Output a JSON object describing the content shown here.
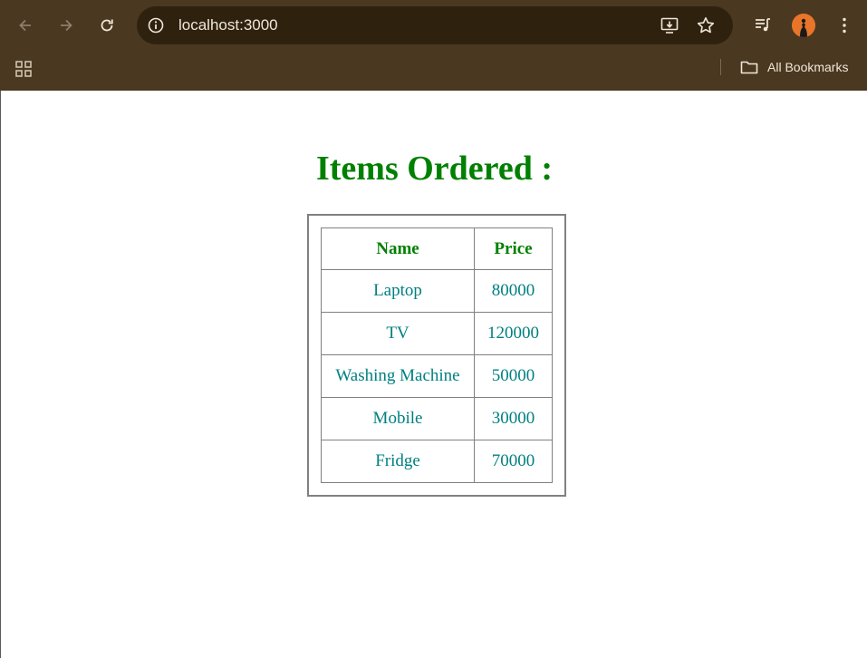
{
  "browser": {
    "url": "localhost:3000",
    "bookmarks_label": "All Bookmarks",
    "icons": [
      "back-arrow-icon",
      "forward-arrow-icon",
      "reload-icon",
      "site-info-icon",
      "install-app-icon",
      "star-icon",
      "media-control-icon",
      "profile-avatar",
      "more-menu-icon",
      "apps-grid-icon",
      "folder-icon"
    ],
    "colors": {
      "frame": "#4a3820",
      "omnibox": "#2e220f"
    }
  },
  "page": {
    "title": "Items Ordered :",
    "table": {
      "headers": {
        "name": "Name",
        "price": "Price"
      },
      "rows": [
        {
          "name": "Laptop",
          "price": "80000"
        },
        {
          "name": "TV",
          "price": "120000"
        },
        {
          "name": "Washing Machine",
          "price": "50000"
        },
        {
          "name": "Mobile",
          "price": "30000"
        },
        {
          "name": "Fridge",
          "price": "70000"
        }
      ]
    },
    "colors": {
      "heading": "#008000",
      "cell_text": "#008080",
      "border": "#808080"
    }
  }
}
